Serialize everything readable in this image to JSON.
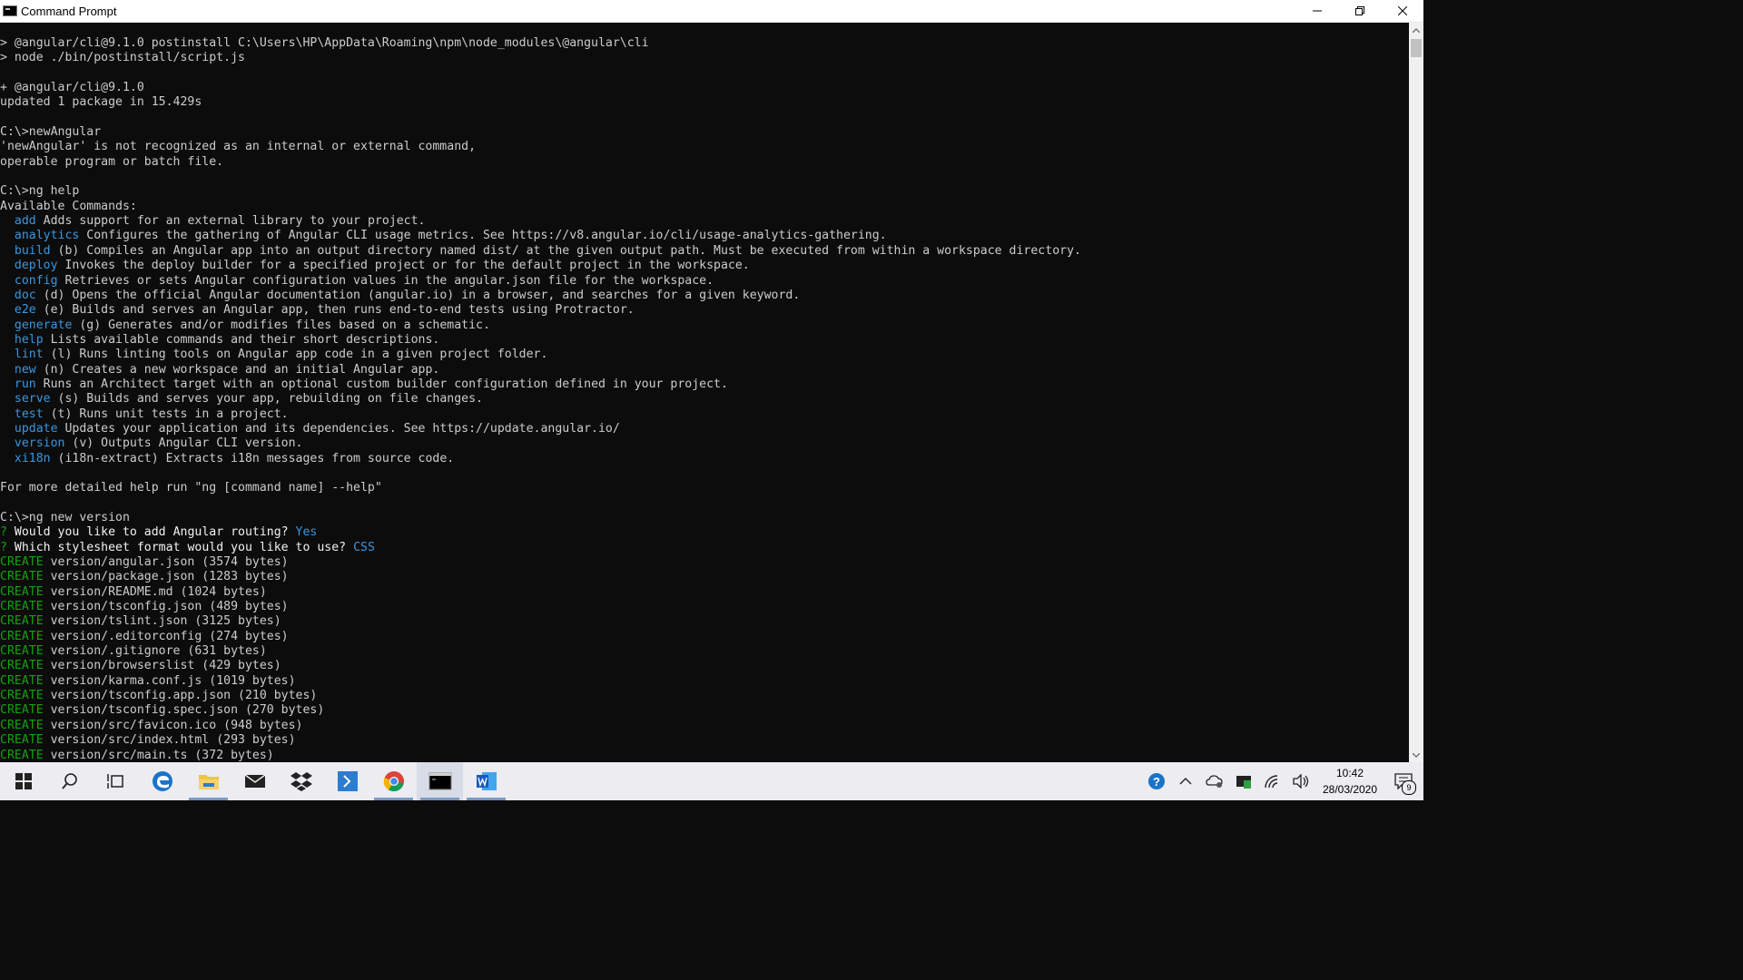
{
  "window": {
    "title": "Command Prompt"
  },
  "console": {
    "lines": [
      {
        "parts": [
          {
            "text": "> @angular/cli@9.1.0 postinstall C:\\Users\\HP\\AppData\\Roaming\\npm\\node_modules\\@angular\\cli"
          }
        ]
      },
      {
        "parts": [
          {
            "text": "> node ./bin/postinstall/script.js"
          }
        ]
      },
      {
        "parts": [
          {
            "text": ""
          }
        ]
      },
      {
        "parts": [
          {
            "text": "+ @angular/cli@9.1.0"
          }
        ]
      },
      {
        "parts": [
          {
            "text": "updated 1 package in 15.429s"
          }
        ]
      },
      {
        "parts": [
          {
            "text": ""
          }
        ]
      },
      {
        "parts": [
          {
            "text": "C:\\>newAngular"
          }
        ]
      },
      {
        "parts": [
          {
            "text": "'newAngular' is not recognized as an internal or external command,"
          }
        ]
      },
      {
        "parts": [
          {
            "text": "operable program or batch file."
          }
        ]
      },
      {
        "parts": [
          {
            "text": ""
          }
        ]
      },
      {
        "parts": [
          {
            "text": "C:\\>ng help"
          }
        ]
      },
      {
        "parts": [
          {
            "text": "Available Commands:"
          }
        ]
      },
      {
        "parts": [
          {
            "text": "  "
          },
          {
            "text": "add",
            "cls": "cmd-name"
          },
          {
            "text": " Adds support for an external library to your project."
          }
        ]
      },
      {
        "parts": [
          {
            "text": "  "
          },
          {
            "text": "analytics",
            "cls": "cmd-name"
          },
          {
            "text": " Configures the gathering of Angular CLI usage metrics. See https://v8.angular.io/cli/usage-analytics-gathering."
          }
        ]
      },
      {
        "parts": [
          {
            "text": "  "
          },
          {
            "text": "build",
            "cls": "cmd-name"
          },
          {
            "text": " (b) Compiles an Angular app into an output directory named dist/ at the given output path. Must be executed from within a workspace directory."
          }
        ]
      },
      {
        "parts": [
          {
            "text": "  "
          },
          {
            "text": "deploy",
            "cls": "cmd-name"
          },
          {
            "text": " Invokes the deploy builder for a specified project or for the default project in the workspace."
          }
        ]
      },
      {
        "parts": [
          {
            "text": "  "
          },
          {
            "text": "config",
            "cls": "cmd-name"
          },
          {
            "text": " Retrieves or sets Angular configuration values in the angular.json file for the workspace."
          }
        ]
      },
      {
        "parts": [
          {
            "text": "  "
          },
          {
            "text": "doc",
            "cls": "cmd-name"
          },
          {
            "text": " (d) Opens the official Angular documentation (angular.io) in a browser, and searches for a given keyword."
          }
        ]
      },
      {
        "parts": [
          {
            "text": "  "
          },
          {
            "text": "e2e",
            "cls": "cmd-name"
          },
          {
            "text": " (e) Builds and serves an Angular app, then runs end-to-end tests using Protractor."
          }
        ]
      },
      {
        "parts": [
          {
            "text": "  "
          },
          {
            "text": "generate",
            "cls": "cmd-name"
          },
          {
            "text": " (g) Generates and/or modifies files based on a schematic."
          }
        ]
      },
      {
        "parts": [
          {
            "text": "  "
          },
          {
            "text": "help",
            "cls": "cmd-name"
          },
          {
            "text": " Lists available commands and their short descriptions."
          }
        ]
      },
      {
        "parts": [
          {
            "text": "  "
          },
          {
            "text": "lint",
            "cls": "cmd-name"
          },
          {
            "text": " (l) Runs linting tools on Angular app code in a given project folder."
          }
        ]
      },
      {
        "parts": [
          {
            "text": "  "
          },
          {
            "text": "new",
            "cls": "cmd-name"
          },
          {
            "text": " (n) Creates a new workspace and an initial Angular app."
          }
        ]
      },
      {
        "parts": [
          {
            "text": "  "
          },
          {
            "text": "run",
            "cls": "cmd-name"
          },
          {
            "text": " Runs an Architect target with an optional custom builder configuration defined in your project."
          }
        ]
      },
      {
        "parts": [
          {
            "text": "  "
          },
          {
            "text": "serve",
            "cls": "cmd-name"
          },
          {
            "text": " (s) Builds and serves your app, rebuilding on file changes."
          }
        ]
      },
      {
        "parts": [
          {
            "text": "  "
          },
          {
            "text": "test",
            "cls": "cmd-name"
          },
          {
            "text": " (t) Runs unit tests in a project."
          }
        ]
      },
      {
        "parts": [
          {
            "text": "  "
          },
          {
            "text": "update",
            "cls": "cmd-name"
          },
          {
            "text": " Updates your application and its dependencies. See https://update.angular.io/"
          }
        ]
      },
      {
        "parts": [
          {
            "text": "  "
          },
          {
            "text": "version",
            "cls": "cmd-name"
          },
          {
            "text": " (v) Outputs Angular CLI version."
          }
        ]
      },
      {
        "parts": [
          {
            "text": "  "
          },
          {
            "text": "xi18n",
            "cls": "cmd-name"
          },
          {
            "text": " (i18n-extract) Extracts i18n messages from source code."
          }
        ]
      },
      {
        "parts": [
          {
            "text": ""
          }
        ]
      },
      {
        "parts": [
          {
            "text": "For more detailed help run \"ng [command name] --help\""
          }
        ]
      },
      {
        "parts": [
          {
            "text": ""
          }
        ]
      },
      {
        "parts": [
          {
            "text": "C:\\>ng new version"
          }
        ]
      },
      {
        "parts": [
          {
            "text": "?",
            "cls": "prompt-q"
          },
          {
            "text": " Would you like to add Angular routing? ",
            "cls": "white"
          },
          {
            "text": "Yes",
            "cls": "answer"
          }
        ]
      },
      {
        "parts": [
          {
            "text": "?",
            "cls": "prompt-q"
          },
          {
            "text": " Which stylesheet format would you like to use? ",
            "cls": "white"
          },
          {
            "text": "CSS",
            "cls": "answer"
          }
        ]
      },
      {
        "parts": [
          {
            "text": "CREATE",
            "cls": "create"
          },
          {
            "text": " version/angular.json (3574 bytes)"
          }
        ]
      },
      {
        "parts": [
          {
            "text": "CREATE",
            "cls": "create"
          },
          {
            "text": " version/package.json (1283 bytes)"
          }
        ]
      },
      {
        "parts": [
          {
            "text": "CREATE",
            "cls": "create"
          },
          {
            "text": " version/README.md (1024 bytes)"
          }
        ]
      },
      {
        "parts": [
          {
            "text": "CREATE",
            "cls": "create"
          },
          {
            "text": " version/tsconfig.json (489 bytes)"
          }
        ]
      },
      {
        "parts": [
          {
            "text": "CREATE",
            "cls": "create"
          },
          {
            "text": " version/tslint.json (3125 bytes)"
          }
        ]
      },
      {
        "parts": [
          {
            "text": "CREATE",
            "cls": "create"
          },
          {
            "text": " version/.editorconfig (274 bytes)"
          }
        ]
      },
      {
        "parts": [
          {
            "text": "CREATE",
            "cls": "create"
          },
          {
            "text": " version/.gitignore (631 bytes)"
          }
        ]
      },
      {
        "parts": [
          {
            "text": "CREATE",
            "cls": "create"
          },
          {
            "text": " version/browserslist (429 bytes)"
          }
        ]
      },
      {
        "parts": [
          {
            "text": "CREATE",
            "cls": "create"
          },
          {
            "text": " version/karma.conf.js (1019 bytes)"
          }
        ]
      },
      {
        "parts": [
          {
            "text": "CREATE",
            "cls": "create"
          },
          {
            "text": " version/tsconfig.app.json (210 bytes)"
          }
        ]
      },
      {
        "parts": [
          {
            "text": "CREATE",
            "cls": "create"
          },
          {
            "text": " version/tsconfig.spec.json (270 bytes)"
          }
        ]
      },
      {
        "parts": [
          {
            "text": "CREATE",
            "cls": "create"
          },
          {
            "text": " version/src/favicon.ico (948 bytes)"
          }
        ]
      },
      {
        "parts": [
          {
            "text": "CREATE",
            "cls": "create"
          },
          {
            "text": " version/src/index.html (293 bytes)"
          }
        ]
      },
      {
        "parts": [
          {
            "text": "CREATE",
            "cls": "create"
          },
          {
            "text": " version/src/main.ts (372 bytes)"
          }
        ]
      }
    ]
  },
  "taskbar": {
    "apps": [
      {
        "name": "start-button",
        "icon": "windows-logo-icon"
      },
      {
        "name": "search-button",
        "icon": "search-icon"
      },
      {
        "name": "task-view-button",
        "icon": "task-view-icon"
      },
      {
        "name": "edge-app",
        "icon": "edge-icon"
      },
      {
        "name": "file-explorer-app",
        "icon": "folder-icon"
      },
      {
        "name": "mail-app",
        "icon": "mail-icon"
      },
      {
        "name": "dropbox-app",
        "icon": "dropbox-icon"
      },
      {
        "name": "powershell-app",
        "icon": "powershell-icon"
      },
      {
        "name": "chrome-app",
        "icon": "chrome-icon"
      },
      {
        "name": "command-prompt-app",
        "icon": "terminal-icon"
      },
      {
        "name": "word-app",
        "icon": "word-icon"
      }
    ],
    "clock": {
      "time": "10:42",
      "date": "28/03/2020"
    },
    "notification_count": "9"
  },
  "colors": {
    "console_bg": "#0c0c0c",
    "console_text": "#cccccc",
    "command_blue": "#3a96dd",
    "create_green": "#13a10e",
    "taskbar_bg": "#ececf1"
  }
}
